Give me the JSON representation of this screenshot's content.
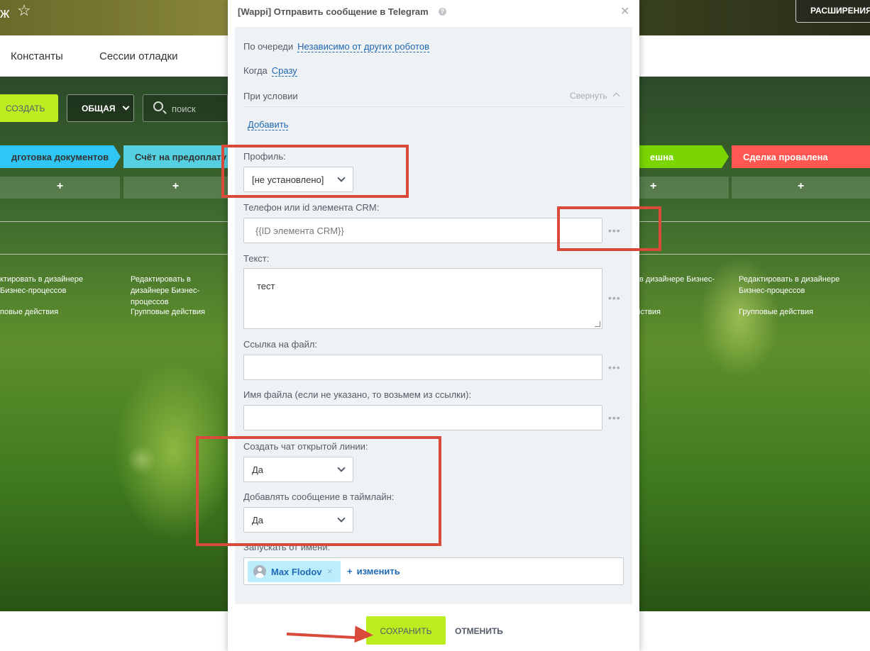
{
  "background": {
    "title_fragment": "ж",
    "star_icon": "star-outline-icon",
    "extensions_label": "РАСШИРЕНИЯ",
    "nav_tabs": [
      "Константы",
      "Сессии отладки"
    ],
    "create_label": "СОЗДАТЬ",
    "general_label": "ОБЩАЯ",
    "search_placeholder": "поиск",
    "stages": [
      {
        "label": "дготовка документов",
        "color": "#2fc6f6"
      },
      {
        "label": "Счёт на предоплату",
        "color": "#55d0e0"
      },
      {
        "label": "ешна",
        "color": "#7bd500"
      },
      {
        "label": "Сделка провалена",
        "color": "#ff5752"
      }
    ],
    "add_symbol": "+",
    "column_links": {
      "edit_left": "ктировать в дизайнере Бизнес-процессов",
      "edit_mid": "Редактировать в дизайнере Бизнес-процессов",
      "edit_right_a": "в дизайнере Бизнес-",
      "edit_right_b": "Редактировать в дизайнере Бизнес-процессов",
      "group_left": "повые действия",
      "group_mid": "Групповые действия",
      "group_right_a": "Групповые действия",
      "group_right_b": "Групповые действия"
    }
  },
  "dialog": {
    "title": "[Wappi] Отправить сообщение в Telegram",
    "queue_label": "По очереди",
    "queue_value": "Независимо от других роботов",
    "when_label": "Когда",
    "when_value": "Сразу",
    "condition_label": "При условии",
    "collapse_label": "Свернуть",
    "add_label": "Добавить",
    "profile_label": "Профиль:",
    "profile_value": "[не установлено]",
    "phone_label": "Телефон или id элемента CRM:",
    "phone_value": "{{ID элемента CRM}}",
    "text_label": "Текст:",
    "text_value": "тест",
    "file_url_label": "Ссылка на файл:",
    "file_url_value": "",
    "file_name_label": "Имя файла (если не указано, то возьмем из ссылки):",
    "file_name_value": "",
    "open_line_label": "Создать чат открытой линии:",
    "open_line_value": "Да",
    "timeline_label": "Добавлять сообщение в таймлайн:",
    "timeline_value": "Да",
    "run_as_label": "Запускать от имени:",
    "run_as_user": "Max Flodov",
    "change_label": "изменить",
    "dots": "•••",
    "save_label": "СОХРАНИТЬ",
    "cancel_label": "ОТМЕНИТЬ"
  },
  "annotation_color": "#d94a3a"
}
